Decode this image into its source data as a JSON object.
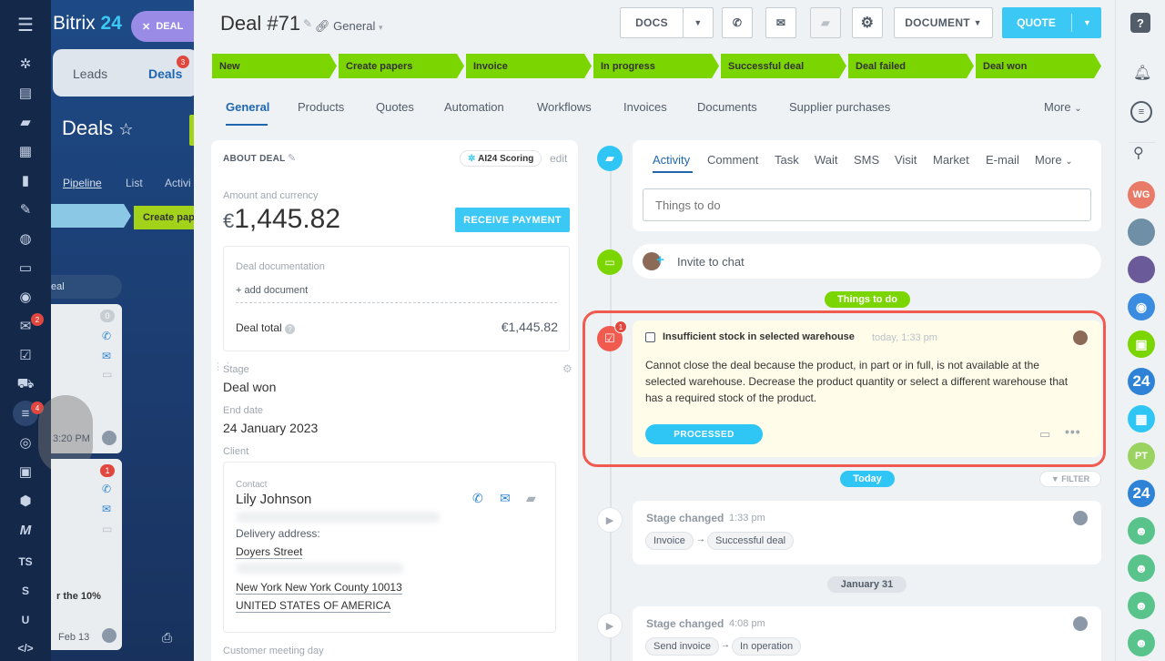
{
  "app": {
    "logo": "Bitrix",
    "logo_num": "24",
    "deal_chip": "DEAL"
  },
  "left_rail": {
    "badges": [
      "2",
      "4"
    ],
    "texts": [
      "TS",
      "S",
      "U"
    ]
  },
  "bg": {
    "tabs": [
      "Leads",
      "Deals"
    ],
    "deals_badge": "3",
    "title": "Deals",
    "views": [
      "Pipeline",
      "List",
      "Activi"
    ],
    "stage_label": "Create pap",
    "col_label": "eal",
    "time": "3:20 PM",
    "count0": "0",
    "count1": "1",
    "note": "r the 10%",
    "date": "Feb 13"
  },
  "header": {
    "title": "Deal #71",
    "category": "General",
    "docs": "DOCS",
    "document": "DOCUMENT",
    "quote": "QUOTE"
  },
  "stages": [
    "New",
    "Create papers",
    "Invoice",
    "In progress",
    "Successful deal",
    "Deal failed",
    "Deal won"
  ],
  "tabs": [
    "General",
    "Products",
    "Quotes",
    "Automation",
    "Workflows",
    "Invoices",
    "Documents",
    "Supplier purchases",
    "More"
  ],
  "about": {
    "heading": "ABOUT DEAL",
    "scoring": "AI24 Scoring",
    "edit": "edit",
    "amount_label": "Amount and currency",
    "currency": "€",
    "amount": "1,445.82",
    "receive_payment": "RECEIVE PAYMENT",
    "doc_label": "Deal documentation",
    "add_doc": "+ add document",
    "total_label": "Deal total",
    "total_value": "€1,445.82",
    "stage_label": "Stage",
    "stage_value": "Deal won",
    "end_label": "End date",
    "end_value": "24 January 2023",
    "client_label": "Client",
    "contact_label": "Contact",
    "contact_name": "Lily Johnson",
    "delivery_label": "Delivery address:",
    "street": "Doyers Street",
    "city": "New York New York County 10013",
    "country": "UNITED STATES OF AMERICA",
    "meeting_label": "Customer meeting day"
  },
  "activity": {
    "tabs": [
      "Activity",
      "Comment",
      "Task",
      "Wait",
      "SMS",
      "Visit",
      "Market",
      "E-mail",
      "More"
    ],
    "placeholder": "Things to do",
    "invite": "Invite to chat",
    "things_badge": "Things to do",
    "task_badge": "1",
    "task_title": "Insufficient stock in selected warehouse",
    "task_time": "today, 1:33 pm",
    "task_text": "Cannot close the deal because the product, in part or in full, is not available at the selected warehouse. Decrease the product quantity or select a different warehouse that has a required stock of the product.",
    "processed": "PROCESSED",
    "today": "Today",
    "filter": "FILTER",
    "event1_title": "Stage changed",
    "event1_time": "1:33 pm",
    "event1_from": "Invoice",
    "event1_to": "Successful deal",
    "date2": "January 31",
    "event2_title": "Stage changed",
    "event2_time": "4:08 pm",
    "event2_from": "Send invoice",
    "event2_to": "In operation"
  },
  "right_rail": {
    "avatars": [
      "WG",
      "PT"
    ],
    "b24": "24"
  },
  "colors": {
    "accent": "#3bc8f5",
    "stage_green": "#7bd500",
    "alert": "#f05a4f",
    "task_bg": "#fffdea"
  }
}
